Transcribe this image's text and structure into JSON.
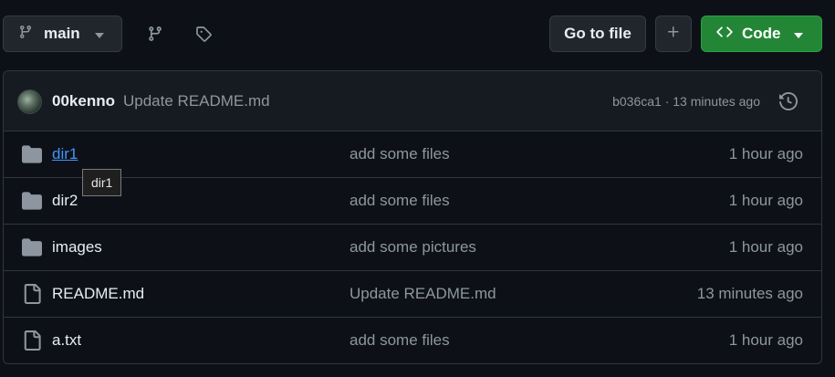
{
  "toolbar": {
    "branch_label": "main",
    "goto_label": "Go to file",
    "plus_label": "+",
    "code_label": "Code"
  },
  "commit": {
    "author": "00kenno",
    "message": "Update README.md",
    "hash": "b036ca1",
    "separator": "·",
    "time": "13 minutes ago"
  },
  "files": [
    {
      "name": "dir1",
      "type": "folder",
      "message": "add some files",
      "time": "1 hour ago"
    },
    {
      "name": "dir2",
      "type": "folder",
      "message": "add some files",
      "time": "1 hour ago"
    },
    {
      "name": "images",
      "type": "folder",
      "message": "add some pictures",
      "time": "1 hour ago"
    },
    {
      "name": "README.md",
      "type": "file",
      "message": "Update README.md",
      "time": "13 minutes ago"
    },
    {
      "name": "a.txt",
      "type": "file",
      "message": "add some files",
      "time": "1 hour ago"
    }
  ],
  "tooltip": {
    "text": "dir1"
  },
  "colors": {
    "background": "#0d1117",
    "accent_green": "#238636",
    "link_blue": "#4493f8",
    "muted_text": "#8d96a0"
  }
}
